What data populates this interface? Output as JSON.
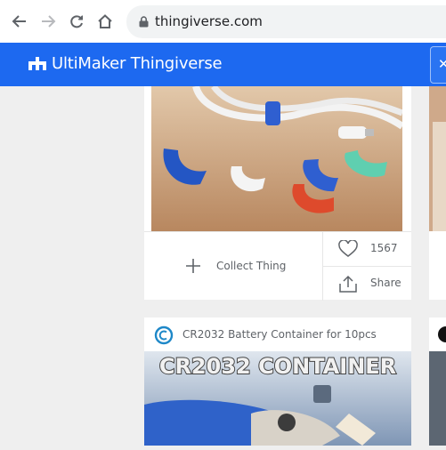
{
  "browser": {
    "url": "thingiverse.com",
    "icons": [
      "back-arrow-icon",
      "forward-arrow-icon",
      "reload-icon",
      "home-icon",
      "lock-icon"
    ]
  },
  "site_header": {
    "brand": "UltiMaker Thingiverse",
    "brand_color": "#1d69f0",
    "logo_icon": "ultimaker-logo-icon"
  },
  "card1": {
    "collect_label": "Collect Thing",
    "like_count": "1567",
    "share_label": "Share",
    "icons": [
      "plus-icon",
      "heart-icon",
      "share-icon"
    ]
  },
  "card2": {
    "title": "CR2032 Battery Container for 10pcs",
    "image_text": "CR2032 CONTAINER"
  }
}
